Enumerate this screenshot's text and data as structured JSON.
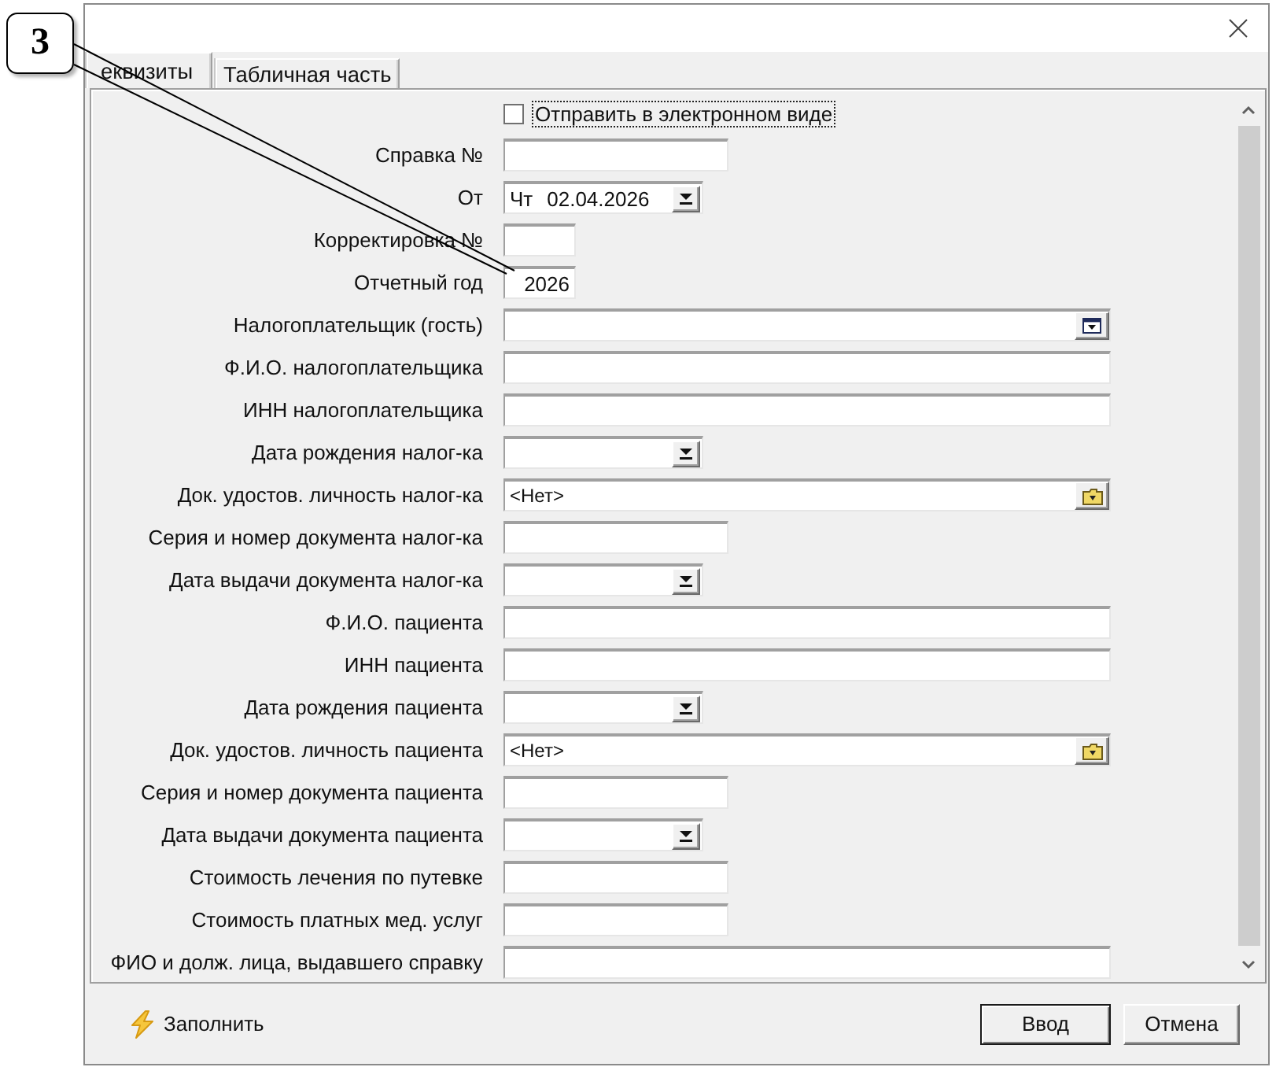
{
  "callout": {
    "number": "3"
  },
  "tabs": [
    {
      "label": "еквизиты",
      "selected": true
    },
    {
      "label": "Табличная часть",
      "selected": false
    }
  ],
  "form": {
    "rows": [
      {
        "kind": "checkbox",
        "label": "Отправить в электронном виде",
        "checked": false,
        "focused": true
      },
      {
        "kind": "text",
        "label": "Справка №"
      },
      {
        "kind": "date",
        "label": "От",
        "weekday": "Чт",
        "value": "02.04.2026"
      },
      {
        "kind": "text",
        "label": "Корректировка №"
      },
      {
        "kind": "text",
        "label": "Отчетный год",
        "value": "2026"
      },
      {
        "kind": "lookup",
        "label": "Налогоплательщик (гость)"
      },
      {
        "kind": "text",
        "label": "Ф.И.О. налогоплательщика"
      },
      {
        "kind": "text",
        "label": "ИНН налогоплательщика"
      },
      {
        "kind": "date",
        "label": "Дата рождения налог-ка"
      },
      {
        "kind": "reference",
        "label": "Док. удостов. личность налог-ка",
        "value": "<Нет>"
      },
      {
        "kind": "text",
        "label": "Серия и номер документа налог-ка"
      },
      {
        "kind": "date",
        "label": "Дата выдачи документа налог-ка"
      },
      {
        "kind": "text",
        "label": "Ф.И.О. пациента"
      },
      {
        "kind": "text",
        "label": "ИНН пациента"
      },
      {
        "kind": "date",
        "label": "Дата рождения пациента"
      },
      {
        "kind": "reference",
        "label": "Док. удостов. личность пациента",
        "value": "<Нет>"
      },
      {
        "kind": "text",
        "label": "Серия и номер документа пациента"
      },
      {
        "kind": "date",
        "label": "Дата выдачи документа пациента"
      },
      {
        "kind": "text",
        "label": "Стоимость лечения по путевке"
      },
      {
        "kind": "text",
        "label": "Стоимость платных мед. услуг"
      },
      {
        "kind": "text",
        "label": "ФИО и долж. лица, выдавшего справку"
      }
    ]
  },
  "footer": {
    "fill_button": {
      "label": "Заполнить"
    },
    "buttons": [
      {
        "label": "Ввод",
        "default": true
      },
      {
        "label": "Отмена",
        "default": false
      }
    ]
  }
}
